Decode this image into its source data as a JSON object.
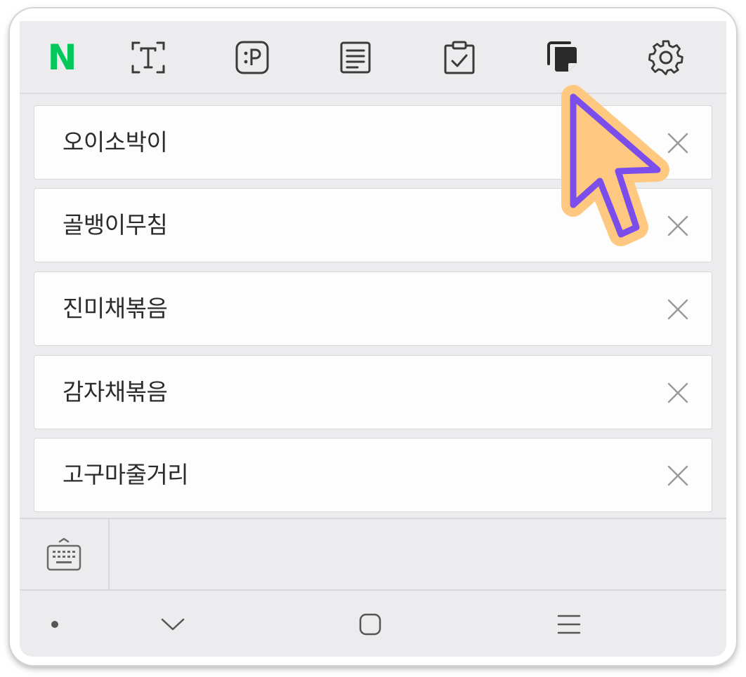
{
  "toolbar": {
    "logo_letter": "N",
    "buttons": [
      {
        "icon": "text-recognition-icon"
      },
      {
        "icon": "emoticon-icon"
      },
      {
        "icon": "note-icon"
      },
      {
        "icon": "clipboard-check-icon"
      },
      {
        "icon": "clipboard-history-icon"
      },
      {
        "icon": "gear-icon"
      }
    ]
  },
  "clipboard_items": [
    {
      "text": "오이소박이"
    },
    {
      "text": "골뱅이무침"
    },
    {
      "text": "진미채볶음"
    },
    {
      "text": "감자채볶음"
    },
    {
      "text": "고구마줄거리"
    }
  ],
  "bottom": {
    "keyboard_icon": "keyboard-icon"
  },
  "navbar": {
    "icons": [
      "dot-icon",
      "chevron-down-icon",
      "home-square-icon",
      "menu-lines-icon"
    ]
  },
  "colors": {
    "logo_green": "#03c75a",
    "cursor_fill": "#ffc880",
    "cursor_stroke": "#7b4dea",
    "icon_gray": "#3a3a3a",
    "close_gray": "#9a9a9a"
  }
}
